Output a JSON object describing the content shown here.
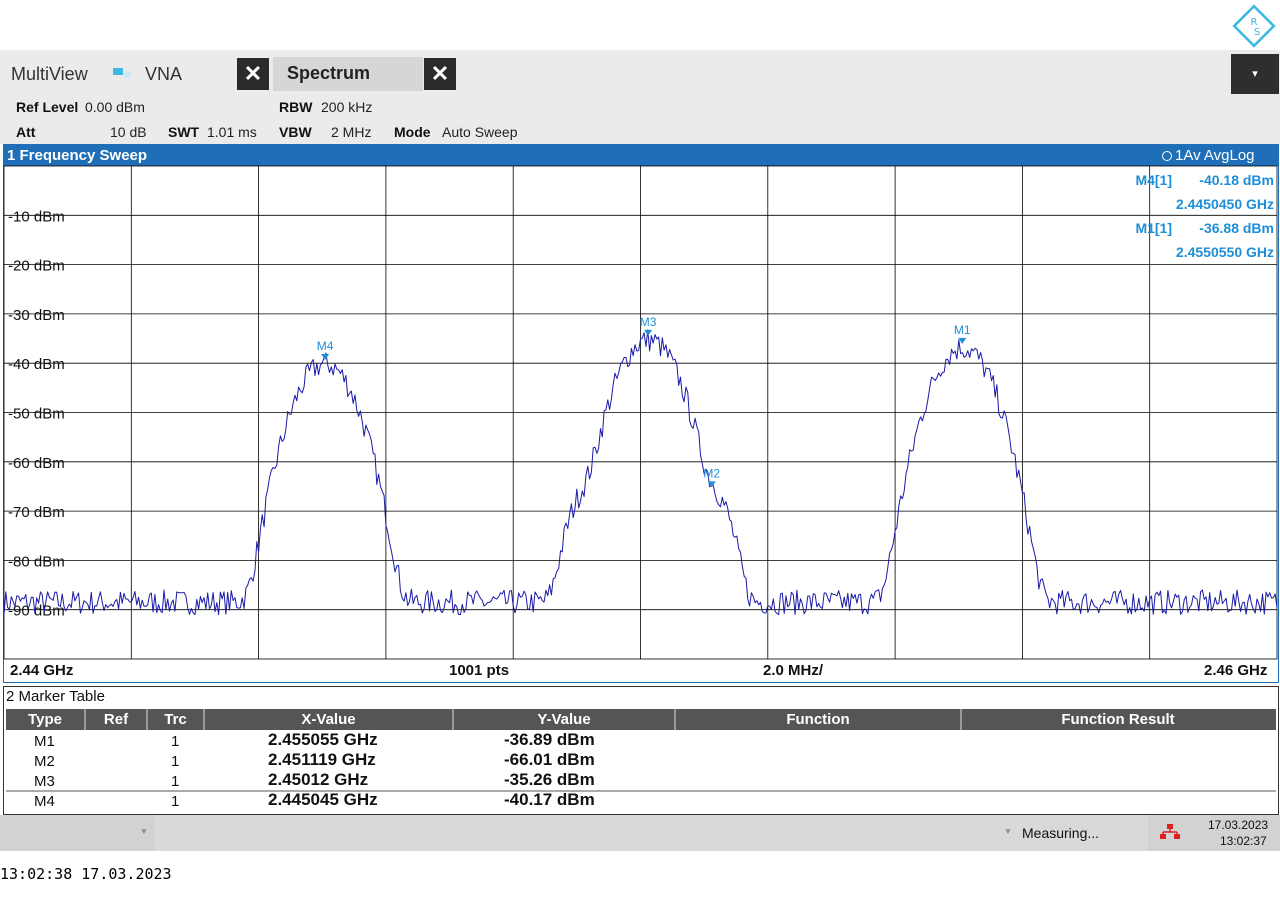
{
  "colors": {
    "accent": "#1e6fb8",
    "trace": "#1a1aa8",
    "marker": "#1e8ed8"
  },
  "tabs": {
    "multiview": "MultiView",
    "vna": "VNA",
    "spectrum": "Spectrum",
    "close_glyph": "✕",
    "menu_glyph": "▾"
  },
  "settings": {
    "ref_level_label": "Ref Level",
    "ref_level_value": "0.00 dBm",
    "att_label": "Att",
    "att_value": "10 dB",
    "swt_label": "SWT",
    "swt_value": "1.01 ms",
    "rbw_label": "RBW",
    "rbw_value": "200 kHz",
    "vbw_label": "VBW",
    "vbw_value": "2 MHz",
    "mode_label": "Mode",
    "mode_value": "Auto Sweep"
  },
  "sweep": {
    "title": "1 Frequency Sweep",
    "trace_mode": "1Av AvgLog",
    "readouts": [
      {
        "name": "M4[1]",
        "level": "-40.18 dBm",
        "freq": "2.4450450 GHz"
      },
      {
        "name": "M1[1]",
        "level": "-36.88 dBm",
        "freq": "2.4550550 GHz"
      }
    ],
    "start": "2.44 GHz",
    "points": "1001 pts",
    "span_per_div": "2.0 MHz/",
    "stop": "2.46 GHz"
  },
  "chart_data": {
    "type": "line",
    "title": "1 Frequency Sweep",
    "xlim": [
      2.44,
      2.46
    ],
    "ylim": [
      -100,
      0
    ],
    "y_ticks": [
      "-10 dBm",
      "-20 dBm",
      "-30 dBm",
      "-40 dBm",
      "-50 dBm",
      "-60 dBm",
      "-70 dBm",
      "-80 dBm",
      "-90 dBm"
    ],
    "grid": true,
    "series": [
      {
        "noise_floor": -88.5,
        "peaks": [
          {
            "x": 2.445045,
            "y": -40.17,
            "width": 0.0006
          },
          {
            "x": 2.45012,
            "y": -35.26,
            "width": 0.0006
          },
          {
            "x": 2.451119,
            "y": -66.01,
            "width": 0.0004
          },
          {
            "x": 2.44915,
            "y": -66.5,
            "width": 0.0004
          },
          {
            "x": 2.455055,
            "y": -36.89,
            "width": 0.0006
          }
        ]
      }
    ],
    "markers": [
      {
        "label": "M1",
        "x": 2.455055,
        "y": -36.89
      },
      {
        "label": "M2",
        "x": 2.451119,
        "y": -66.01
      },
      {
        "label": "M3",
        "x": 2.45012,
        "y": -35.26
      },
      {
        "label": "M4",
        "x": 2.445045,
        "y": -40.17
      }
    ]
  },
  "marker_table": {
    "title": "2 Marker Table",
    "headers": [
      "Type",
      "Ref",
      "Trc",
      "X-Value",
      "Y-Value",
      "Function",
      "Function Result"
    ],
    "rows": [
      {
        "type": "M1",
        "ref": "",
        "trc": "1",
        "x": "2.455055 GHz",
        "y": "-36.89 dBm"
      },
      {
        "type": "M2",
        "ref": "",
        "trc": "1",
        "x": "2.451119 GHz",
        "y": "-66.01 dBm"
      },
      {
        "type": "M3",
        "ref": "",
        "trc": "1",
        "x": "2.45012 GHz",
        "y": "-35.26 dBm"
      },
      {
        "type": "M4",
        "ref": "",
        "trc": "1",
        "x": "2.445045 GHz",
        "y": "-40.17 dBm"
      }
    ]
  },
  "status": {
    "measuring": "Measuring...",
    "date": "17.03.2023",
    "time": "13:02:37"
  },
  "footer": {
    "timestamp": "13:02:38  17.03.2023"
  }
}
